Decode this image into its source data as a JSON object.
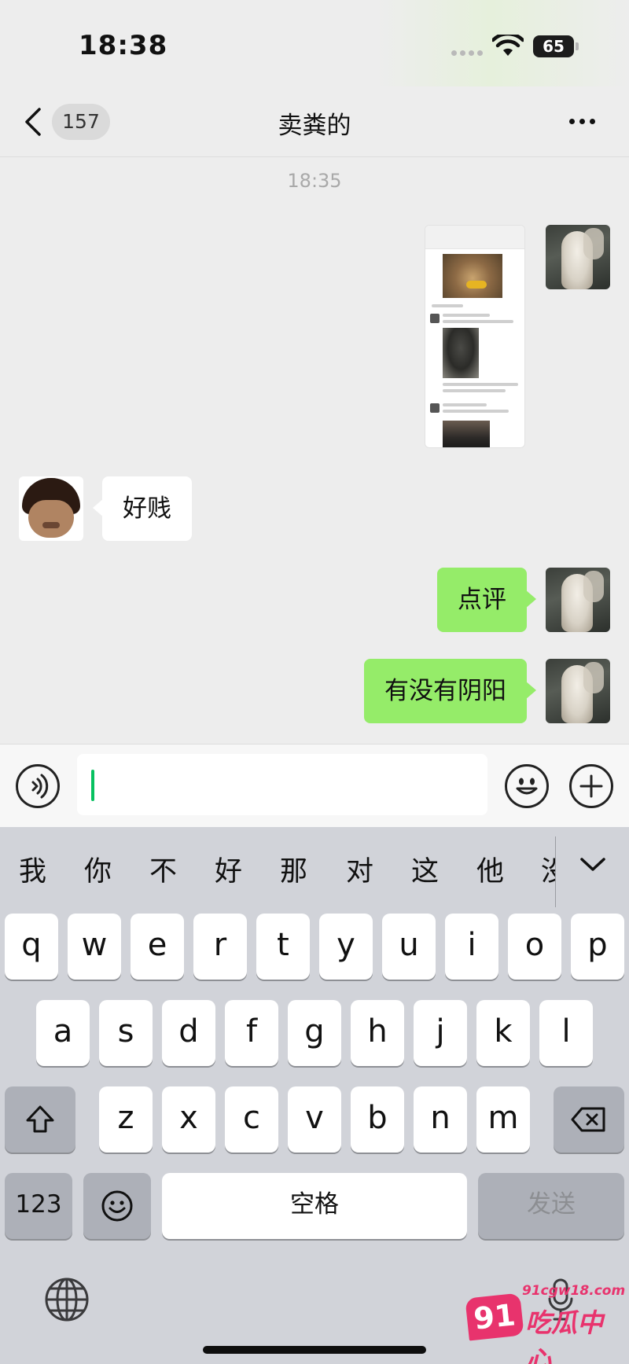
{
  "status_bar": {
    "time": "18:38",
    "battery": "65"
  },
  "header": {
    "back_count": "157",
    "title": "卖粪的"
  },
  "chat": {
    "timestamp": "18:35",
    "messages": [
      {
        "from": "me",
        "type": "image",
        "content": "screenshot"
      },
      {
        "from": "other",
        "type": "text",
        "text": "好贱"
      },
      {
        "from": "me",
        "type": "text",
        "text": "点评"
      },
      {
        "from": "me",
        "type": "text",
        "text": "有没有阴阳"
      }
    ]
  },
  "input": {
    "value": ""
  },
  "keyboard": {
    "candidates": [
      "我",
      "你",
      "不",
      "好",
      "那",
      "对",
      "这",
      "他",
      "没"
    ],
    "row1": [
      "q",
      "w",
      "e",
      "r",
      "t",
      "y",
      "u",
      "i",
      "o",
      "p"
    ],
    "row2": [
      "a",
      "s",
      "d",
      "f",
      "g",
      "h",
      "j",
      "k",
      "l"
    ],
    "row3": [
      "z",
      "x",
      "c",
      "v",
      "b",
      "n",
      "m"
    ],
    "numbers_key": "123",
    "space_key": "空格",
    "send_key": "发送"
  },
  "watermark": {
    "logo": "91",
    "url": "91cgw18.com",
    "name": "吃瓜中心"
  },
  "colors": {
    "bubble_green": "#95ec69",
    "caret": "#07c160",
    "background": "#ededed",
    "keyboard_bg": "#d1d3d9",
    "watermark": "#e8336d"
  }
}
